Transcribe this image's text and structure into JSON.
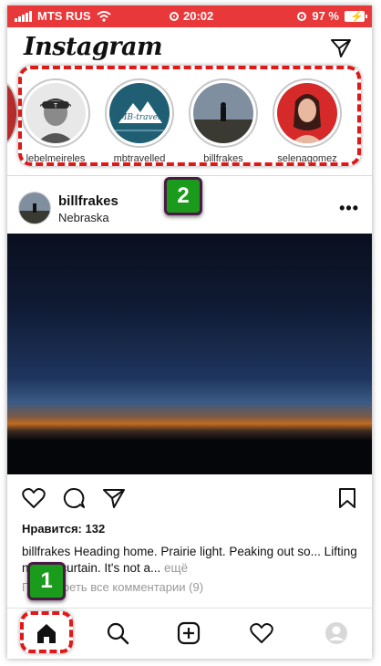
{
  "status": {
    "carrier": "MTS RUS",
    "time": "20:02",
    "battery": "97 %"
  },
  "header": {
    "logo": "Instagram"
  },
  "stories": [
    {
      "name": "lebelmeireles"
    },
    {
      "name": "mbtravelled"
    },
    {
      "name": "billfrakes"
    },
    {
      "name": "selenagomez"
    }
  ],
  "post": {
    "username": "billfrakes",
    "location": "Nebraska",
    "likes": "Нравится: 132",
    "caption_user": "billfrakes",
    "caption_text": " Heading home.  Prairie light.  Peaking out so... Lifting night's curtain.  It's not a...",
    "caption_more": "ещё",
    "comments": "Посмотреть все комментарии (9)"
  },
  "annotations": {
    "badge_home": "1",
    "badge_stories": "2"
  }
}
